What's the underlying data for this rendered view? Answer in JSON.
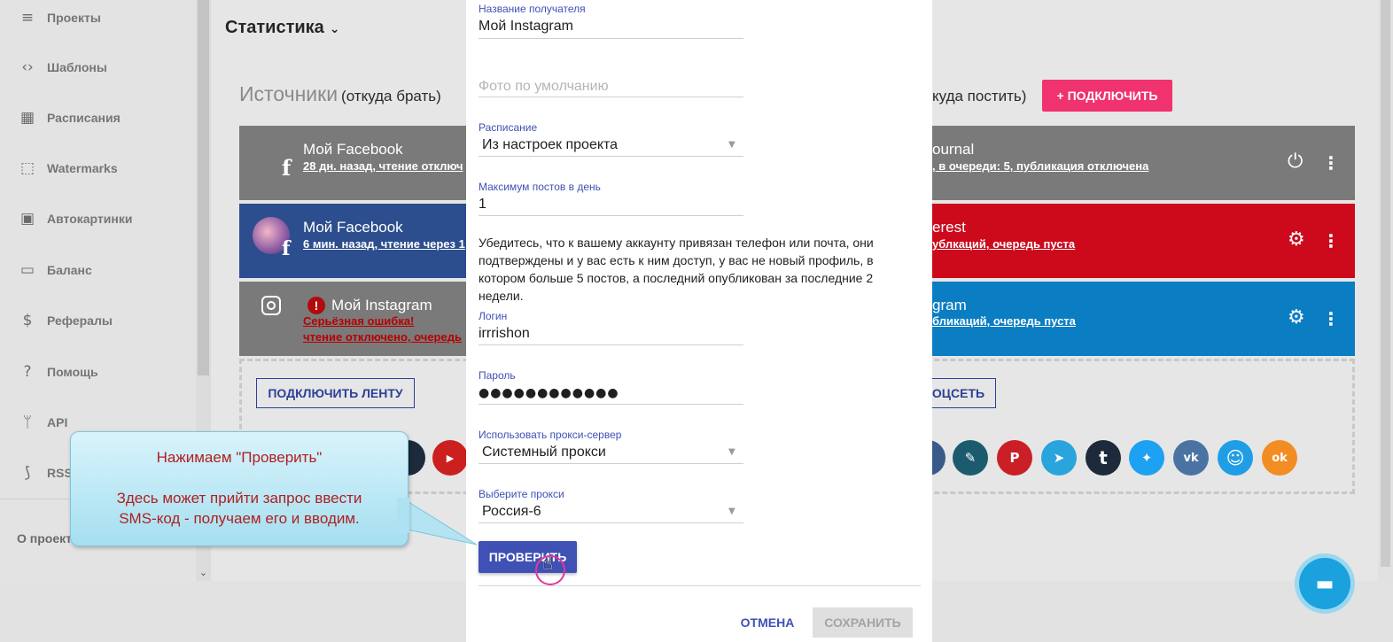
{
  "sidebar": {
    "items": [
      {
        "label": "Проекты",
        "icon": "list-icon",
        "glyph": "≡"
      },
      {
        "label": "Шаблоны",
        "icon": "code-icon",
        "glyph": "‹›"
      },
      {
        "label": "Расписания",
        "icon": "calendar-icon",
        "glyph": "▦"
      },
      {
        "label": "Watermarks",
        "icon": "watermark-icon",
        "glyph": "⬚"
      },
      {
        "label": "Автокартинки",
        "icon": "autoimage-icon",
        "glyph": "▣"
      },
      {
        "label": "Баланс",
        "icon": "credit-card-icon",
        "glyph": "▭"
      },
      {
        "label": "Рефералы",
        "icon": "dollar-icon",
        "glyph": "$"
      },
      {
        "label": "Помощь",
        "icon": "help-icon",
        "glyph": "?"
      },
      {
        "label": "API",
        "icon": "api-icon",
        "glyph": "ᛘ"
      },
      {
        "label": "RSS",
        "icon": "rss-icon",
        "glyph": "⟆"
      }
    ],
    "about": "О проекте"
  },
  "main": {
    "title": "Статистика",
    "sources_title": "Источники",
    "sources_sub": "(откуда брать)",
    "dest_sub": "куда постить)",
    "connect_label": "+ ПОДКЛЮЧИТЬ",
    "connect_feed_label": "ПОДКЛЮЧИТЬ ЛЕНТУ",
    "connect_network_label": "ОЦСЕТЬ"
  },
  "sources": [
    {
      "title": "Мой Facebook",
      "status": "28 дн. назад, чтение отключ",
      "color": "#7a7a7a",
      "icon": "facebook-icon"
    },
    {
      "title": "Мой Facebook",
      "status": "6 мин. назад, чтение через 1",
      "color": "#2c4e8e",
      "icon": "facebook-avatar"
    },
    {
      "title": "Мой Instagram",
      "error": "Серьёзная ошибка!",
      "status": "чтение отключено, очередь",
      "color": "#7a7a7a",
      "icon": "instagram-icon"
    }
  ],
  "destinations": [
    {
      "title": "ournal",
      "status": ", в очереди: 5, публикация отключена",
      "color": "#7a7a7a",
      "action": "power-icon"
    },
    {
      "title": "erest",
      "status": "ублкаций, очередь пуста",
      "color": "#cc0a1c",
      "action": "settings-icon"
    },
    {
      "title": "gram",
      "status": "бликаций, очередь пуста",
      "color": "#0b7dc2",
      "action": "settings-icon"
    }
  ],
  "socials": [
    {
      "name": "youtube-icon",
      "color": "#cc1f1f",
      "glyph": "▶"
    },
    {
      "name": "livejournal-icon",
      "color": "#1b5b6d",
      "glyph": "✎"
    },
    {
      "name": "pinterest-icon",
      "color": "#cb1f27",
      "glyph": "P"
    },
    {
      "name": "telegram-icon",
      "color": "#2aa4dd",
      "glyph": "➤"
    },
    {
      "name": "tumblr-icon",
      "color": "#1c2a3b",
      "glyph": "t"
    },
    {
      "name": "twitter-icon",
      "color": "#1da1f2",
      "glyph": "✦"
    },
    {
      "name": "vk-icon",
      "color": "#4a73a3",
      "glyph": "vk"
    },
    {
      "name": "smile-icon",
      "color": "#1f9ee5",
      "glyph": "☺"
    },
    {
      "name": "odnoklassniki-icon",
      "color": "#f28d23",
      "glyph": "ok"
    }
  ],
  "modal": {
    "recipient_label": "Название получателя",
    "recipient_value": "Мой Instagram",
    "photo_placeholder": "Фото по умолчанию",
    "schedule_label": "Расписание",
    "schedule_value": "Из настроек проекта",
    "max_posts_label": "Максимум постов в день",
    "max_posts_value": "1",
    "notice": "Убедитесь, что к вашему аккаунту привязан телефон или почта, они подтверждены и у вас есть к ним доступ, у вас не новый профиль, в котором больше 5 постов, а последний опубликован за последние 2 недели.",
    "login_label": "Логин",
    "login_value": "irrrishon",
    "password_label": "Пароль",
    "password_value": "●●●●●●●●●●●●",
    "proxy_label": "Использовать прокси-сервер",
    "proxy_value": "Системный прокси",
    "choose_proxy_label": "Выберите прокси",
    "choose_proxy_value": "Россия-6",
    "check_label": "ПРОВЕРИТЬ",
    "cancel_label": "ОТМЕНА",
    "save_label": "СОХРАНИТЬ"
  },
  "callout": {
    "line1": "Нажимаем \"Проверить\"",
    "line2": "Здесь может прийти запрос ввести",
    "line3": "SMS-код - получаем его и вводим."
  }
}
